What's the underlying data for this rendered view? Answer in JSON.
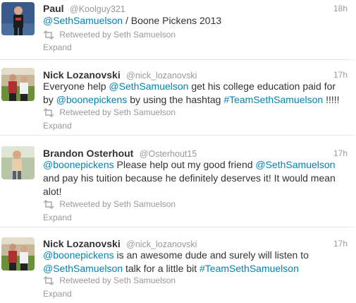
{
  "tweets": [
    {
      "name": "Paul",
      "handle": "@Koolguy321",
      "time": "18h",
      "text_parts": [
        {
          "t": "@SethSamuelson",
          "link": true
        },
        {
          "t": " / Boone Pickens 2013",
          "link": false
        }
      ],
      "retweeted_by": "Retweeted by Seth Samuelson",
      "expand": "Expand"
    },
    {
      "name": "Nick Lozanovski",
      "handle": "@nick_lozanovski",
      "time": "17h",
      "text_parts": [
        {
          "t": "Everyone help ",
          "link": false
        },
        {
          "t": "@SethSamuelson",
          "link": true
        },
        {
          "t": " get his college education paid for by ",
          "link": false
        },
        {
          "t": "@boonepickens",
          "link": true
        },
        {
          "t": " by using the hashtag ",
          "link": false
        },
        {
          "t": "#TeamSethSamuelson",
          "link": true
        },
        {
          "t": " !!!!!",
          "link": false
        }
      ],
      "retweeted_by": "Retweeted by Seth Samuelson",
      "expand": "Expand"
    },
    {
      "name": "Brandon Osterhout",
      "handle": "@Osterhout15",
      "time": "17h",
      "text_parts": [
        {
          "t": "@boonepickens",
          "link": true
        },
        {
          "t": " Please help out my good friend ",
          "link": false
        },
        {
          "t": "@SethSamuelson",
          "link": true
        },
        {
          "t": " and pay his tuition because he definitely deserves it! It would mean alot!",
          "link": false
        }
      ],
      "retweeted_by": "Retweeted by Seth Samuelson",
      "expand": "Expand"
    },
    {
      "name": "Nick Lozanovski",
      "handle": "@nick_lozanovski",
      "time": "17h",
      "text_parts": [
        {
          "t": "@boonepickens",
          "link": true
        },
        {
          "t": " is an awesome dude and surely will listen to ",
          "link": false
        },
        {
          "t": "@SethSamuelson",
          "link": true
        },
        {
          "t": " talk for a little bit ",
          "link": false
        },
        {
          "t": "#TeamSethSamuelson",
          "link": true
        }
      ],
      "retweeted_by": "Retweeted by Seth Samuelson",
      "expand": "Expand"
    }
  ],
  "colors": {
    "link": "#0084b4",
    "text": "#333333",
    "muted": "#999999",
    "divider": "#e8e8e8"
  },
  "icons": {
    "retweet": "retweet-icon"
  }
}
